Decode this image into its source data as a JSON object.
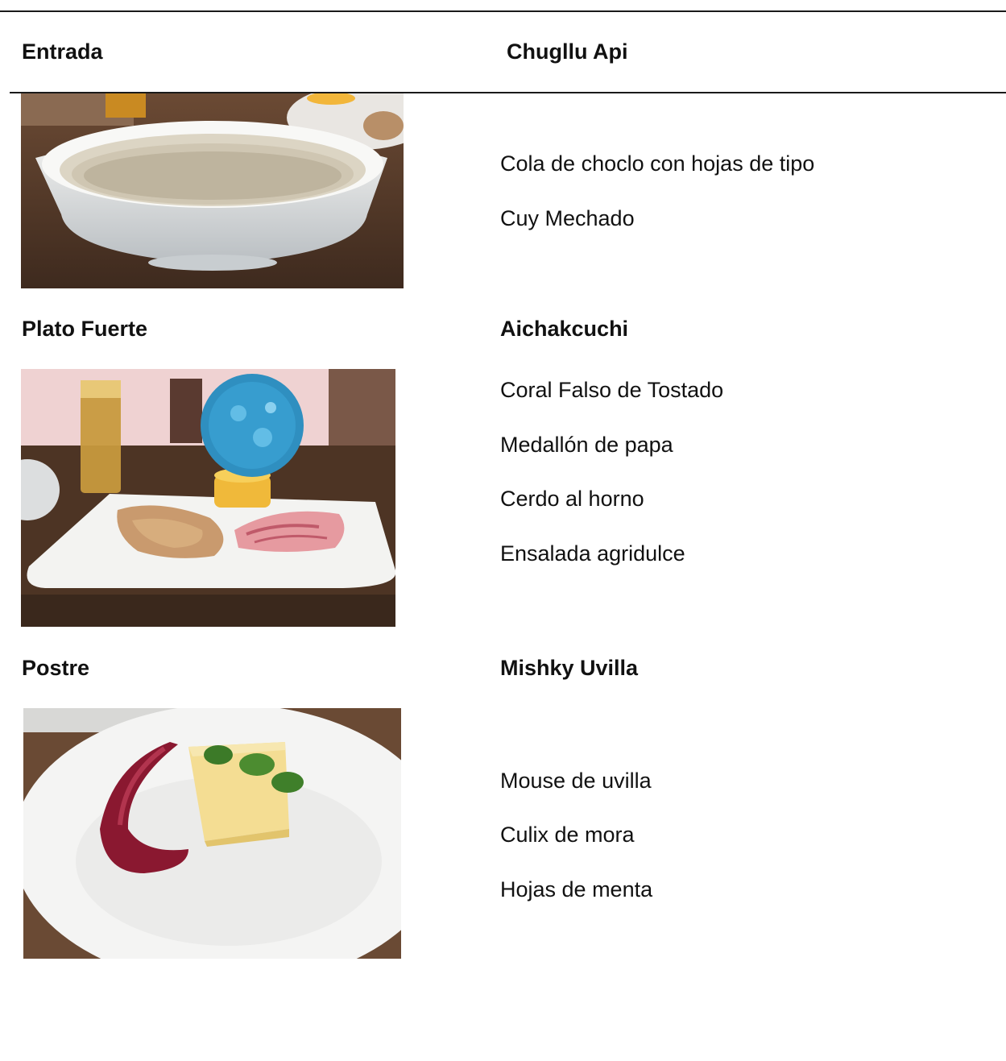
{
  "header": {
    "left_label": "Entrada",
    "right_label": "Chugllu Api"
  },
  "sections": [
    {
      "course": "",
      "dish": "",
      "photo_icon": "soup-bowl-photo",
      "items": [
        "Cola de choclo con hojas de tipo",
        "Cuy Mechado"
      ]
    },
    {
      "course": "Plato Fuerte",
      "dish": "Aichakcuchi",
      "photo_icon": "main-plate-photo",
      "items": [
        "Coral Falso de Tostado",
        "Medallón de papa",
        "Cerdo al horno",
        "Ensalada agridulce"
      ]
    },
    {
      "course": "Postre",
      "dish": "Mishky Uvilla",
      "photo_icon": "dessert-plate-photo",
      "items": [
        "Mouse de uvilla",
        "Culix de mora",
        "Hojas de menta"
      ]
    }
  ],
  "colors": {
    "rule": "#1a1a1a",
    "text": "#111111"
  }
}
